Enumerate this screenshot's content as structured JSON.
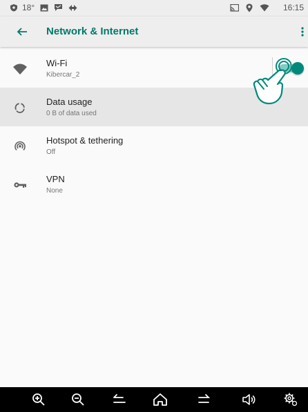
{
  "status_bar": {
    "temperature": "18°",
    "time": "16:15",
    "icons": [
      "shield-icon",
      "image-icon",
      "message-icon",
      "sync-icon",
      "cast-icon",
      "location-icon",
      "wifi-signal-icon"
    ]
  },
  "app_bar": {
    "title": "Network & Internet",
    "back_icon": "arrow-left-icon",
    "overflow_icon": "more-vert-icon"
  },
  "settings": [
    {
      "id": "wifi",
      "icon": "wifi-icon",
      "title": "Wi-Fi",
      "subtitle": "Kibercar_2",
      "toggle": true,
      "toggle_on": true
    },
    {
      "id": "data-usage",
      "icon": "data-usage-icon",
      "title": "Data usage",
      "subtitle": "0 B of data used",
      "highlighted": true
    },
    {
      "id": "hotspot",
      "icon": "hotspot-icon",
      "title": "Hotspot & tethering",
      "subtitle": "Off"
    },
    {
      "id": "vpn",
      "icon": "key-icon",
      "title": "VPN",
      "subtitle": "None"
    }
  ],
  "nav_bar": {
    "buttons": [
      "zoom-in-icon",
      "zoom-out-icon",
      "back-icon",
      "home-icon",
      "recents-icon",
      "volume-icon",
      "settings-icon"
    ]
  },
  "colors": {
    "accent": "#00796b",
    "switch_thumb": "#00897b",
    "switch_track": "#80cbc4",
    "highlight": "#e6e6e6",
    "background": "#fafafa",
    "status_bar": "#eeeeee",
    "nav_bar": "#000000"
  }
}
